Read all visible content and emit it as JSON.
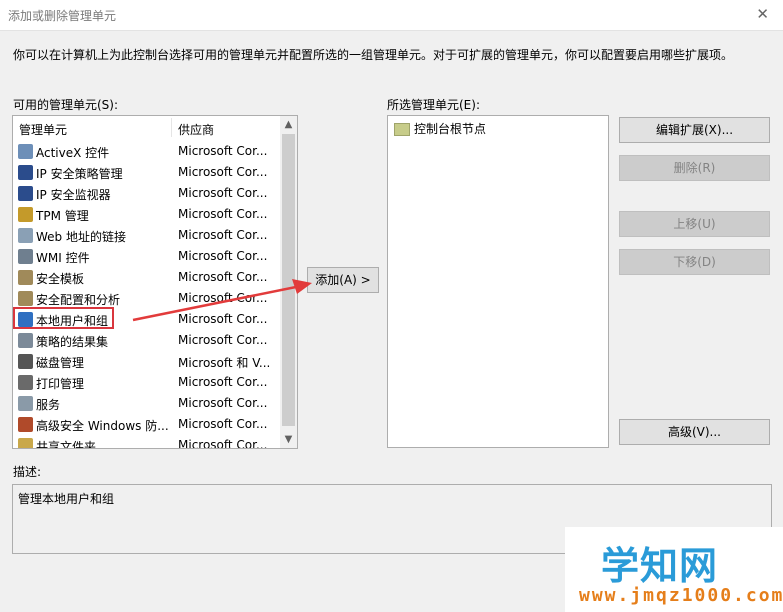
{
  "window": {
    "title": "添加或删除管理单元",
    "close_glyph": "✕"
  },
  "intro_text": "你可以在计算机上为此控制台选择可用的管理单元并配置所选的一组管理单元。对于可扩展的管理单元，你可以配置要启用哪些扩展项。",
  "available": {
    "label": "可用的管理单元(S):",
    "col_name": "管理单元",
    "col_vendor": "供应商",
    "items": [
      {
        "name": "ActiveX 控件",
        "vendor": "Microsoft Cor...",
        "icon": "activex-icon",
        "color": "#6d8fb8"
      },
      {
        "name": "IP 安全策略管理",
        "vendor": "Microsoft Cor...",
        "icon": "ip-security-policy-icon",
        "color": "#2b4c8c"
      },
      {
        "name": "IP 安全监视器",
        "vendor": "Microsoft Cor...",
        "icon": "ip-security-monitor-icon",
        "color": "#2b4c8c"
      },
      {
        "name": "TPM 管理",
        "vendor": "Microsoft Cor...",
        "icon": "tpm-icon",
        "color": "#c49a2a"
      },
      {
        "name": "Web 地址的链接",
        "vendor": "Microsoft Cor...",
        "icon": "web-link-icon",
        "color": "#8aa0b5"
      },
      {
        "name": "WMI 控件",
        "vendor": "Microsoft Cor...",
        "icon": "wmi-icon",
        "color": "#6f7f8f"
      },
      {
        "name": "安全模板",
        "vendor": "Microsoft Cor...",
        "icon": "security-template-icon",
        "color": "#a08a5a"
      },
      {
        "name": "安全配置和分析",
        "vendor": "Microsoft Cor...",
        "icon": "security-config-icon",
        "color": "#a08a5a"
      },
      {
        "name": "本地用户和组",
        "vendor": "Microsoft Cor...",
        "icon": "local-users-icon",
        "color": "#2f6fc1"
      },
      {
        "name": "策略的结果集",
        "vendor": "Microsoft Cor...",
        "icon": "rsop-icon",
        "color": "#7c8a99"
      },
      {
        "name": "磁盘管理",
        "vendor": "Microsoft 和 V...",
        "icon": "disk-icon",
        "color": "#555555"
      },
      {
        "name": "打印管理",
        "vendor": "Microsoft Cor...",
        "icon": "printer-icon",
        "color": "#6a6a6a"
      },
      {
        "name": "服务",
        "vendor": "Microsoft Cor...",
        "icon": "services-icon",
        "color": "#8a9aa8"
      },
      {
        "name": "高级安全 Windows 防...",
        "vendor": "Microsoft Cor...",
        "icon": "firewall-icon",
        "color": "#b04a2a"
      },
      {
        "name": "共享文件夹",
        "vendor": "Microsoft Cor...",
        "icon": "shared-folder-icon",
        "color": "#c9a84a"
      }
    ]
  },
  "add_button": "添加(A) >",
  "selected": {
    "label": "所选管理单元(E):",
    "items": [
      {
        "name": "控制台根节点",
        "icon": "folder-icon"
      }
    ]
  },
  "side_buttons": {
    "edit_extensions": "编辑扩展(X)...",
    "remove": "删除(R)",
    "move_up": "上移(U)",
    "move_down": "下移(D)",
    "advanced": "高级(V)..."
  },
  "description": {
    "label": "描述:",
    "text": "管理本地用户和组"
  },
  "watermark": {
    "text": "学知网",
    "url": "www.jmqz1000.com"
  },
  "colors": {
    "highlight_border": "#d9363e",
    "arrow": "#e23b3b"
  }
}
